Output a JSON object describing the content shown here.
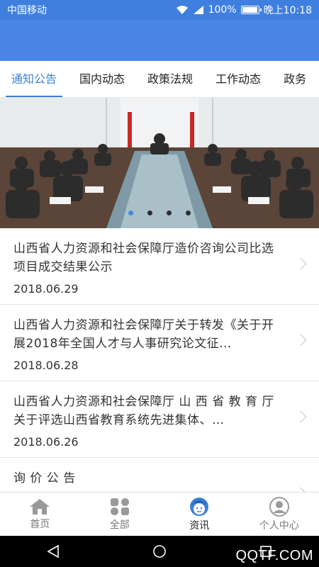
{
  "status_bar": {
    "carrier": "中国移动",
    "battery": "100%",
    "time": "晚上10:18",
    "battery_level": 1.0
  },
  "tabs": [
    {
      "label": "通知公告",
      "active": true
    },
    {
      "label": "国内动态",
      "active": false
    },
    {
      "label": "政策法规",
      "active": false
    },
    {
      "label": "工作动态",
      "active": false
    },
    {
      "label": "政务",
      "active": false
    }
  ],
  "banner": {
    "pages": 4,
    "active_page": 1
  },
  "news": [
    {
      "title": "山西省人力资源和社会保障厅造价咨询公司比选项目成交结果公示",
      "date": "2018.06.29"
    },
    {
      "title": "山西省人力资源和社会保障厅关于转发《关于开展2018年全国人才与人事研究论文征…",
      "date": "2018.06.28"
    },
    {
      "title": "山西省人力资源和社会保障厅 山 西 省 教 育 厅关于评选山西省教育系统先进集体、…",
      "date": "2018.06.26"
    },
    {
      "title": "询 价 公 告",
      "date": ""
    }
  ],
  "bottom_nav": [
    {
      "label": "首页",
      "icon": "home-icon",
      "active": false
    },
    {
      "label": "全部",
      "icon": "grid-icon",
      "active": false
    },
    {
      "label": "资讯",
      "icon": "news-face-icon",
      "active": true
    },
    {
      "label": "个人中心",
      "icon": "person-icon",
      "active": false
    }
  ],
  "watermark": "QQTF.COM",
  "colors": {
    "accent": "#3b82d6",
    "header": "#4a86e8",
    "status": "#3f7fe0"
  }
}
